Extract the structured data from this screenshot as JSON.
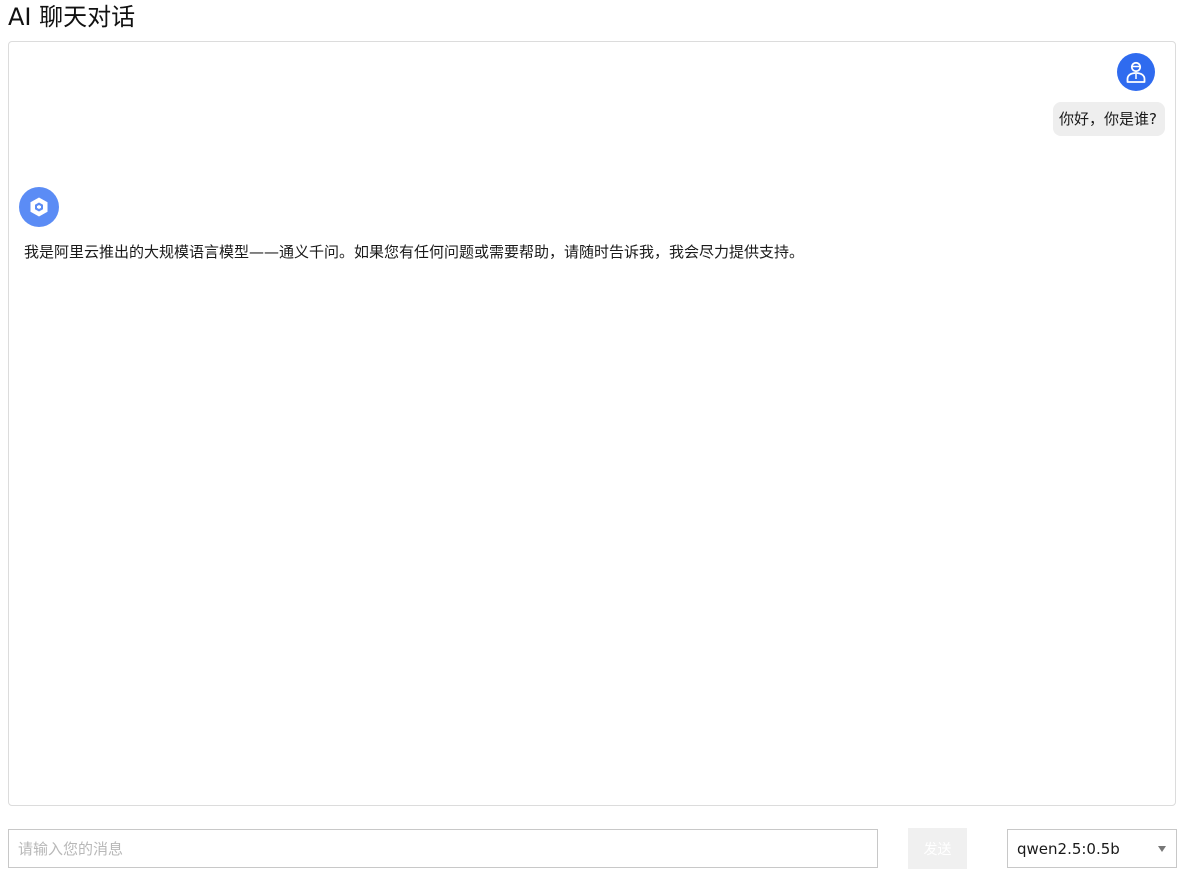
{
  "header": {
    "title": "AI 聊天对话"
  },
  "conversation": {
    "user_message": "你好，你是谁?",
    "assistant_message": "我是阿里云推出的大规模语言模型——通义千问。如果您有任何问题或需要帮助，请随时告诉我，我会尽力提供支持。",
    "user_avatar_icon": "user-avatar-icon",
    "assistant_avatar_icon": "assistant-logo-icon"
  },
  "composer": {
    "placeholder": "请输入您的消息",
    "value": "",
    "send_label": "发送"
  },
  "model_select": {
    "selected": "qwen2.5:0.5b"
  },
  "colors": {
    "user_avatar": "#2f6bef",
    "assistant_avatar": "#5b8cf5",
    "user_bubble": "#eeeeee",
    "send_button_bg": "#f0f0f0",
    "border": "#dcdcdc"
  }
}
